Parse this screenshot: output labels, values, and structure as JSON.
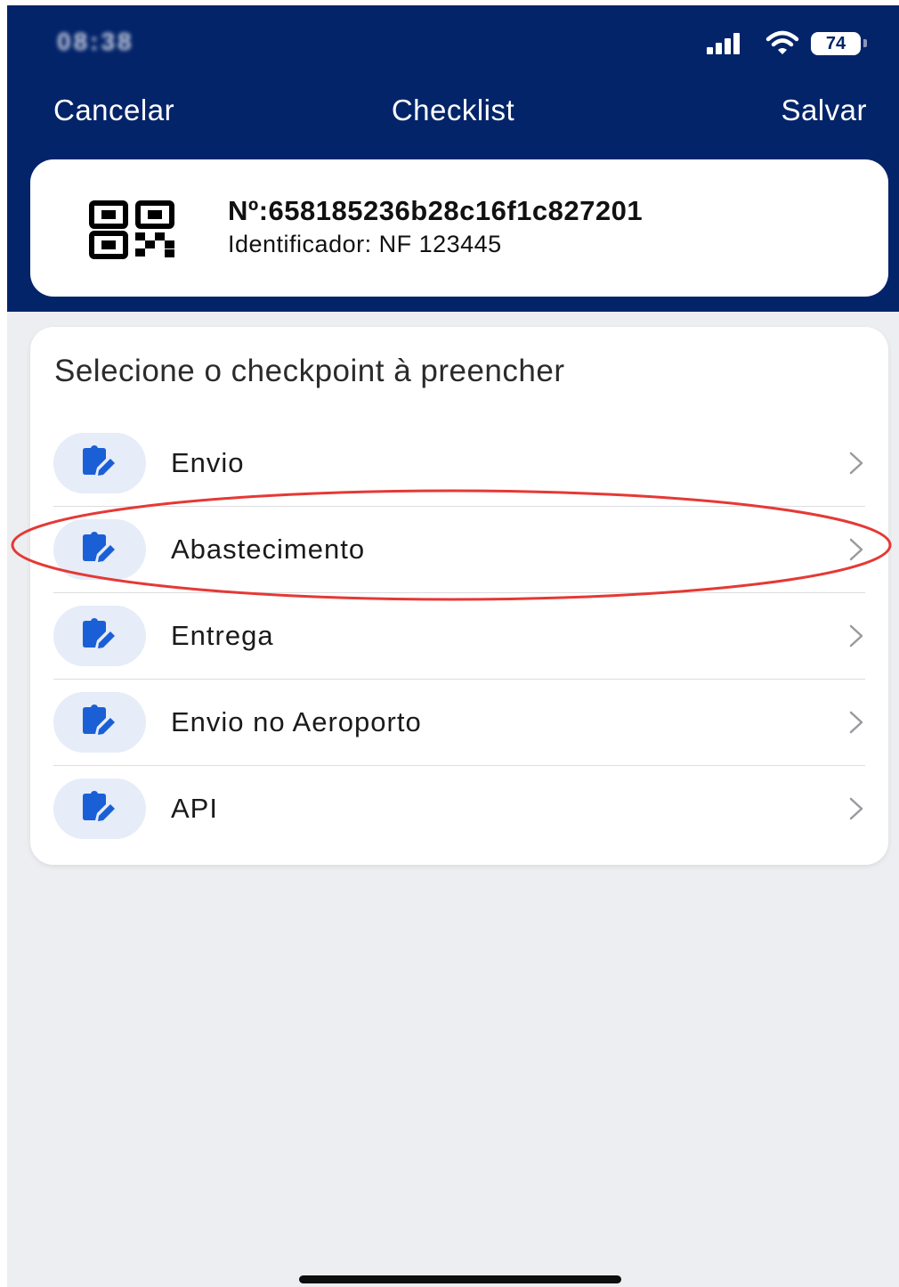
{
  "status_bar": {
    "time": "08:38",
    "battery": "74"
  },
  "nav": {
    "cancel_label": "Cancelar",
    "title": "Checklist",
    "save_label": "Salvar"
  },
  "document": {
    "number": "Nº:658185236b28c16f1c827201",
    "identifier": "Identificador: NF 123445"
  },
  "checkpoints": {
    "title": "Selecione o checkpoint à preencher",
    "items": [
      {
        "label": "Envio"
      },
      {
        "label": "Abastecimento"
      },
      {
        "label": "Entrega"
      },
      {
        "label": "Envio no Aeroporto"
      },
      {
        "label": "API"
      }
    ]
  },
  "colors": {
    "header_bg": "#04246a",
    "icon_blue": "#1a5fd6",
    "annotation_red": "#e53935"
  },
  "icons": {
    "row_icon": "clipboard-edit-icon",
    "row_chevron": "chevron-right-icon",
    "doc_icon": "qr-code-icon"
  }
}
